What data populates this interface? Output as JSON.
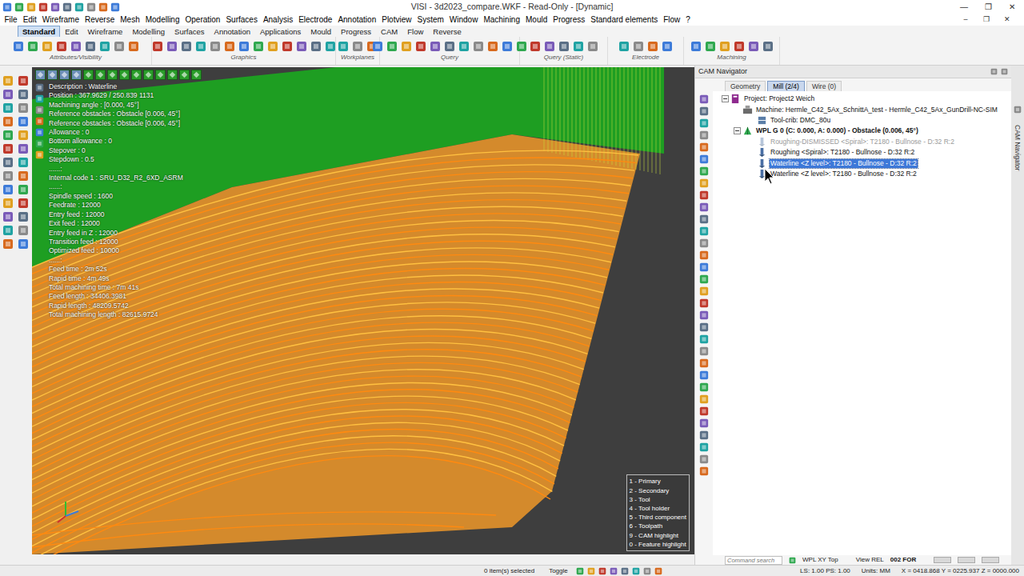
{
  "window": {
    "title": "VISI - 3d2023_compare.WKF - Read-Only - [Dynamic]",
    "controls": [
      "—",
      "❐",
      "✕"
    ],
    "mdi_controls": [
      "–",
      "❐",
      "✕"
    ]
  },
  "menu": [
    "File",
    "Edit",
    "Wireframe",
    "Reverse",
    "Mesh",
    "Modelling",
    "Operation",
    "Surfaces",
    "Analysis",
    "Electrode",
    "Annotation",
    "Plotview",
    "System",
    "Window",
    "Machining",
    "Mould",
    "Progress",
    "Standard elements",
    "Flow",
    "?"
  ],
  "ribbon": {
    "tabs": [
      {
        "label": "Standard",
        "selected": true
      },
      {
        "label": "Edit",
        "selected": false
      },
      {
        "label": "Wireframe",
        "selected": false
      },
      {
        "label": "Modelling",
        "selected": false
      },
      {
        "label": "Surfaces",
        "selected": false
      },
      {
        "label": "Annotation",
        "selected": false
      },
      {
        "label": "Applications",
        "selected": false
      },
      {
        "label": "Mould",
        "selected": false
      },
      {
        "label": "Progress",
        "selected": false
      },
      {
        "label": "CAM",
        "selected": false
      },
      {
        "label": "Flow",
        "selected": false
      },
      {
        "label": "Reverse",
        "selected": false
      }
    ],
    "groups": [
      "Attributes/Visibility",
      "Graphics",
      "Workplanes",
      "Query",
      "Query (Static)",
      "Electrode",
      "Machining"
    ]
  },
  "viewport": {
    "info_lines": [
      "Description : Waterline",
      "Position : 367.9629 / 250.839 1131",
      "Machining angle : [0.000, 45°]",
      "Reference obstacles : Obstacle [0.006, 45°]",
      "Reference obstacles : Obstacle [0.006, 45°]",
      "Allowance : 0",
      "Bottom allowance : 0",
      "Stepover : 0",
      "Stepdown : 0.5",
      "......:",
      "Internal code 1 : SRU_D32_R2_6XD_ASRM",
      "......:",
      "Spindle speed : 1600",
      "Feedrate : 12000",
      "Entry feed : 12000",
      "Exit feed : 12000",
      "Entry feed in Z : 12000",
      "Transition feed : 12000",
      "Optimized feed : 10000",
      "......:",
      "Feed time : 2m 52s",
      "Rapid time : 4m 49s",
      "Total machining time : 7m 41s",
      "Feed length : 34406.3981",
      "Rapid length : 48209.5742",
      "Total machining length : 82615.9724"
    ],
    "legend": [
      "1 - Primary",
      "2 - Secondary",
      "3 - Tool",
      "4 - Tool holder",
      "5 - Third component",
      "6 - Toolpath",
      "9 - CAM highlight",
      "0 - Feature highlight"
    ]
  },
  "cam_navigator": {
    "title": "CAM Navigator",
    "side_label": "CAM Navigator",
    "tabs": [
      {
        "label": "Geometry",
        "selected": false
      },
      {
        "label": "Mill (2/4)",
        "selected": true
      },
      {
        "label": "Wire (0)",
        "selected": false
      }
    ],
    "tree": [
      {
        "label": "Project: Project2 Weich",
        "depth": 0,
        "kind": "project",
        "expanded": true,
        "selected": false,
        "disabled": false,
        "active": false
      },
      {
        "label": "Machine: Hermle_C42_5Ax_SchnittA_test - Hermle_C42_5Ax_GunDrill-NC-SIM",
        "depth": 1,
        "kind": "machine",
        "expanded": false,
        "selected": false,
        "disabled": false,
        "active": false
      },
      {
        "label": "Tool-crib: DMC_80u",
        "depth": 2,
        "kind": "toolcrib",
        "expanded": false,
        "selected": false,
        "disabled": false,
        "active": false
      },
      {
        "label": "WPL G 0 (C: 0.000, A: 0.000) - Obstacle (0.006, 45°)",
        "depth": 1,
        "kind": "workplane",
        "expanded": true,
        "selected": false,
        "disabled": false,
        "active": true
      },
      {
        "label": "Roughing-DISMISSED <Spiral>: T2180 - Bullnose - D:32 R:2",
        "depth": 2,
        "kind": "operation",
        "expanded": false,
        "selected": false,
        "disabled": true,
        "active": false
      },
      {
        "label": "Roughing <Spiral>: T2180 - Bullnose - D:32 R:2",
        "depth": 2,
        "kind": "operation",
        "expanded": false,
        "selected": false,
        "disabled": false,
        "active": false
      },
      {
        "label": "Waterline <Z level>: T2180 - Bullnose - D:32 R:2",
        "depth": 2,
        "kind": "operation",
        "expanded": false,
        "selected": true,
        "disabled": false,
        "active": false
      },
      {
        "label": "Waterline <Z level>: T2180 - Bullnose - D:32 R:2",
        "depth": 2,
        "kind": "operation",
        "expanded": false,
        "selected": false,
        "disabled": false,
        "active": false
      }
    ]
  },
  "command_bar": {
    "command_search": "Command search",
    "workplane": "WPL XY Top",
    "view": "View REL",
    "mode": "002 FOR"
  },
  "status_bar": {
    "selection": "0 item(s) selected",
    "toggle": "Toggle",
    "scale": "LS: 1.00 PS: 1.00",
    "units": "Units: MM",
    "coords": "X = 0418.868 Y = 0225.937 Z = 0000.000"
  }
}
